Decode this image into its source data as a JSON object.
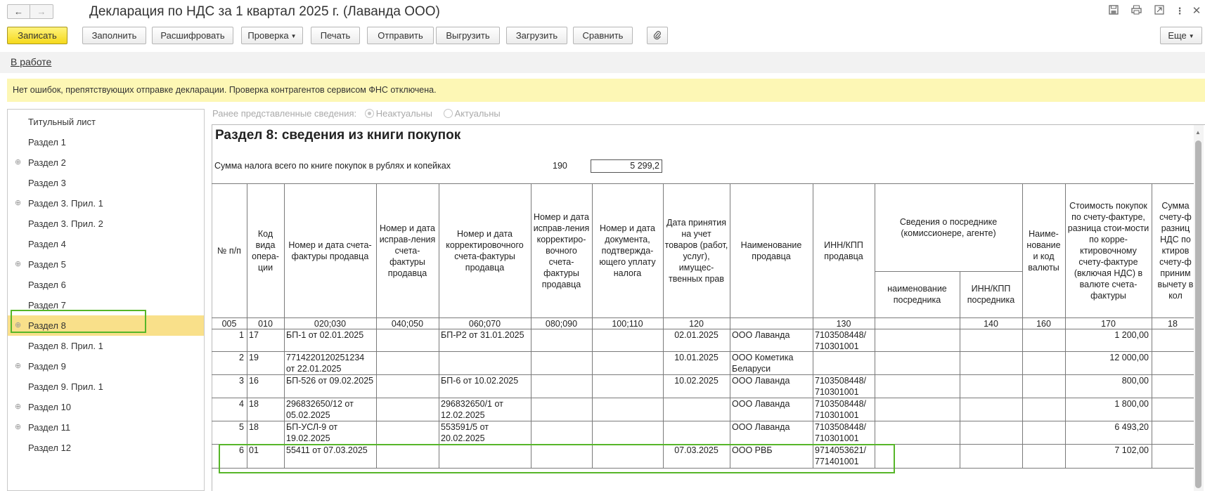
{
  "window": {
    "title": "Декларация по НДС за 1 квартал 2025 г. (Лаванда ООО)",
    "back_icon": "←",
    "forward_icon": "→",
    "icons": [
      "save-icon",
      "print-icon",
      "link-icon",
      "more-icon",
      "close-icon"
    ]
  },
  "toolbar": {
    "save": "Записать",
    "fill": "Заполнить",
    "decode": "Расшифровать",
    "check": "Проверка",
    "print": "Печать",
    "send": "Отправить",
    "export": "Выгрузить",
    "import": "Загрузить",
    "compare": "Сравнить",
    "more": "Еще"
  },
  "status": {
    "link": "В работе"
  },
  "info": {
    "message": "Нет ошибок, препятствующих отправке декларации. Проверка контрагентов сервисом ФНС отключена."
  },
  "nav": {
    "items": [
      {
        "label": "Титульный лист",
        "expandable": false
      },
      {
        "label": "Раздел 1",
        "expandable": false
      },
      {
        "label": "Раздел 2",
        "expandable": true
      },
      {
        "label": "Раздел 3",
        "expandable": false
      },
      {
        "label": "Раздел 3. Прил. 1",
        "expandable": true
      },
      {
        "label": "Раздел 3. Прил. 2",
        "expandable": false
      },
      {
        "label": "Раздел 4",
        "expandable": false
      },
      {
        "label": "Раздел 5",
        "expandable": true
      },
      {
        "label": "Раздел 6",
        "expandable": false
      },
      {
        "label": "Раздел 7",
        "expandable": false
      },
      {
        "label": "Раздел 8",
        "expandable": true,
        "selected": true
      },
      {
        "label": "Раздел 8. Прил. 1",
        "expandable": false
      },
      {
        "label": "Раздел 9",
        "expandable": true
      },
      {
        "label": "Раздел 9. Прил. 1",
        "expandable": false
      },
      {
        "label": "Раздел 10",
        "expandable": true
      },
      {
        "label": "Раздел 11",
        "expandable": true
      },
      {
        "label": "Раздел 12",
        "expandable": false
      }
    ]
  },
  "prev_info": {
    "label": "Ранее представленные сведения:",
    "option_irrelevant": "Неактуальны",
    "option_relevant": "Актуальны",
    "selected": "Неактуальны"
  },
  "section": {
    "title": "Раздел 8: сведения из книги покупок",
    "sum_label": "Сумма налога всего по книге покупок в рублях и копейках",
    "sum_code": "190",
    "sum_value": "5 299,2"
  },
  "table": {
    "headers": {
      "c1": "№ п/п",
      "c2": "Код вида опера-ции",
      "c3": "Номер и дата счета-фактуры продавца",
      "c4": "Номер и дата исправ-ления счета-фактуры продавца",
      "c5": "Номер и дата корректировочного счета-фактуры продавца",
      "c6": "Номер и дата исправ-ления корректиро-вочного счета-фактуры продавца",
      "c7": "Номер и дата документа, подтвержда-ющего уплату налога",
      "c8": "Дата принятия на учет товаров (работ, услуг), имущес-твенных прав",
      "c9": "Наименование продавца",
      "c10": "ИНН/КПП продавца",
      "c11_group": "Сведения о посреднике (комиссионере, агенте)",
      "c11": "наименование посредника",
      "c12": "ИНН/КПП посредника",
      "c13": "Наиме-нование и код валюты",
      "c14": "Стоимость покупок по счету-фактуре, разница стои-мости по корре-ктировочному счету-фактуре (включая НДС) в валюте счета-фактуры",
      "c15": "Сумма счету-ф разниц НДС по ктиров счету-ф приним вычету в кол"
    },
    "codes": [
      "005",
      "010",
      "020;030",
      "040;050",
      "060;070",
      "080;090",
      "100;110",
      "120",
      "",
      "130",
      "",
      "140",
      "160",
      "170",
      "18"
    ],
    "rows": [
      {
        "n": "1",
        "op": "17",
        "invoice": "БП-1 от 02.01.2025",
        "fix": "",
        "corr": "БП-Р2 от 31.01.2025",
        "corrfix": "",
        "paydoc": "",
        "date": "02.01.2025",
        "seller": "ООО Лаванда",
        "inn": "7103508448/ 710301001",
        "agent": "",
        "agent_inn": "",
        "cur": "",
        "amount": "1 200,00"
      },
      {
        "n": "2",
        "op": "19",
        "invoice": "7714220120251234 от 22.01.2025",
        "fix": "",
        "corr": "",
        "corrfix": "",
        "paydoc": "",
        "date": "10.01.2025",
        "seller": "ООО Кометика Беларуси",
        "inn": "",
        "agent": "",
        "agent_inn": "",
        "cur": "",
        "amount": "12 000,00"
      },
      {
        "n": "3",
        "op": "16",
        "invoice": "БП-526 от 09.02.2025",
        "fix": "",
        "corr": "БП-6 от 10.02.2025",
        "corrfix": "",
        "paydoc": "",
        "date": "10.02.2025",
        "seller": "ООО Лаванда",
        "inn": "7103508448/ 710301001",
        "agent": "",
        "agent_inn": "",
        "cur": "",
        "amount": "800,00"
      },
      {
        "n": "4",
        "op": "18",
        "invoice": "296832650/12 от 05.02.2025",
        "fix": "",
        "corr": "296832650/1 от 12.02.2025",
        "corrfix": "",
        "paydoc": "",
        "date": "",
        "seller": "ООО Лаванда",
        "inn": "7103508448/ 710301001",
        "agent": "",
        "agent_inn": "",
        "cur": "",
        "amount": "1 800,00"
      },
      {
        "n": "5",
        "op": "18",
        "invoice": "БП-УСЛ-9 от 19.02.2025",
        "fix": "",
        "corr": "553591/5 от 20.02.2025",
        "corrfix": "",
        "paydoc": "",
        "date": "",
        "seller": "ООО Лаванда",
        "inn": "7103508448/ 710301001",
        "agent": "",
        "agent_inn": "",
        "cur": "",
        "amount": "6 493,20"
      },
      {
        "n": "6",
        "op": "01",
        "invoice": "55411 от 07.03.2025",
        "fix": "",
        "corr": "",
        "corrfix": "",
        "paydoc": "",
        "date": "07.03.2025",
        "seller": "ООО РВБ",
        "inn": "9714053621/ 771401001",
        "agent": "",
        "agent_inn": "",
        "cur": "",
        "amount": "7 102,00"
      }
    ]
  },
  "colors": {
    "primary_button": "#f5d91b",
    "info_bar": "#fdf7b5",
    "nav_selected": "#f9e08a",
    "highlight_frame": "#57b629"
  }
}
